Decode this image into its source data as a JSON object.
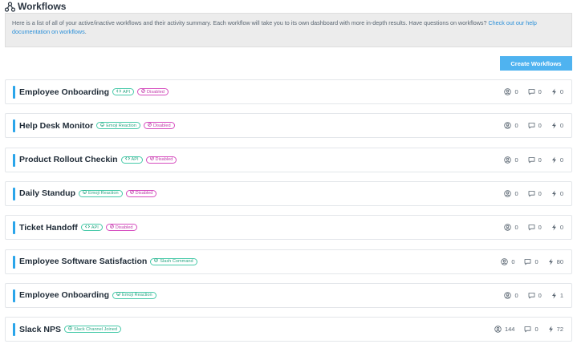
{
  "header": {
    "title": "Workflows"
  },
  "info": {
    "text": "Here is a list of all of your active/inactive workflows and their activity summary. Each workflow will take you to its own dashboard with more in-depth results. Have questions on workflows? ",
    "link": "Check out our help documentation on workflows",
    "suffix": "."
  },
  "actions": {
    "create_label": "Create Workflows"
  },
  "workflows": [
    {
      "name": "Employee Onboarding",
      "badges": [
        {
          "label": "API",
          "type": "api"
        },
        {
          "label": "Disabled",
          "type": "disabled"
        }
      ],
      "participants": "0",
      "responses": "0",
      "runs": "0"
    },
    {
      "name": "Help Desk Monitor",
      "badges": [
        {
          "label": "Emoji Reaction",
          "type": "emoji"
        },
        {
          "label": "Disabled",
          "type": "disabled"
        }
      ],
      "participants": "0",
      "responses": "0",
      "runs": "0"
    },
    {
      "name": "Product Rollout Checkin",
      "badges": [
        {
          "label": "API",
          "type": "api"
        },
        {
          "label": "Disabled",
          "type": "disabled"
        }
      ],
      "participants": "0",
      "responses": "0",
      "runs": "0"
    },
    {
      "name": "Daily Standup",
      "badges": [
        {
          "label": "Emoji Reaction",
          "type": "emoji"
        },
        {
          "label": "Disabled",
          "type": "disabled"
        }
      ],
      "participants": "0",
      "responses": "0",
      "runs": "0"
    },
    {
      "name": "Ticket Handoff",
      "badges": [
        {
          "label": "API",
          "type": "api"
        },
        {
          "label": "Disabled",
          "type": "disabled"
        }
      ],
      "participants": "0",
      "responses": "0",
      "runs": "0"
    },
    {
      "name": "Employee Software Satisfaction",
      "badges": [
        {
          "label": "Slash Command",
          "type": "slash"
        }
      ],
      "participants": "0",
      "responses": "0",
      "runs": "80"
    },
    {
      "name": "Employee Onboarding",
      "badges": [
        {
          "label": "Emoji Reaction",
          "type": "emoji"
        }
      ],
      "participants": "0",
      "responses": "0",
      "runs": "1"
    },
    {
      "name": "Slack NPS",
      "badges": [
        {
          "label": "Slack Channel Joined",
          "type": "channel"
        }
      ],
      "participants": "144",
      "responses": "0",
      "runs": "72"
    }
  ],
  "colors": {
    "accent": "#2aa5ea",
    "button": "#4fb3f0",
    "teal_badge": "#45c9a8",
    "pink_badge": "#d64cbf",
    "link": "#2a8fd8"
  },
  "icons": {
    "header": "workflow-icon",
    "participants": "user-circle-icon",
    "responses": "comment-icon",
    "runs": "lightning-icon",
    "api": "code-icon",
    "disabled": "ban-icon",
    "emoji": "smiley-icon",
    "slash": "slash-icon",
    "channel": "channel-icon"
  }
}
